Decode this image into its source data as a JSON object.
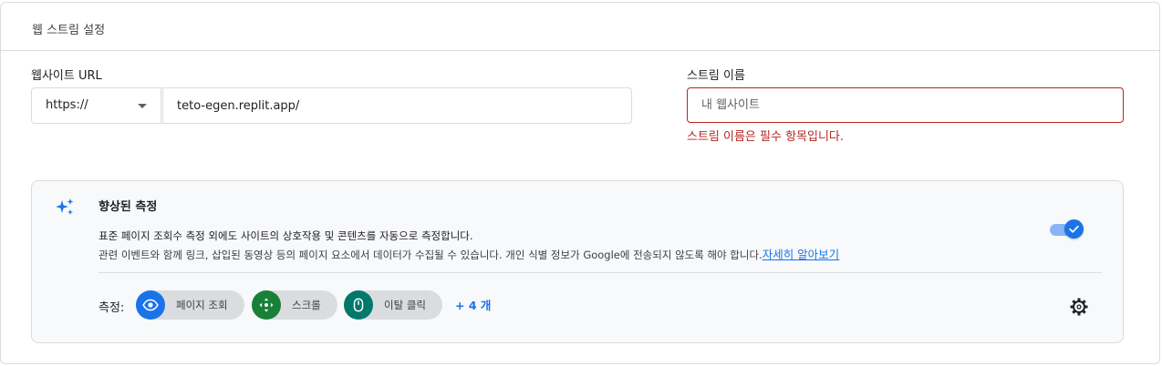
{
  "section": {
    "title": "웹 스트림 설정"
  },
  "website_url": {
    "label": "웹사이트 URL",
    "protocol": "https://",
    "value": "teto-egen.replit.app/"
  },
  "stream_name": {
    "label": "스트림 이름",
    "placeholder": "내 웹사이트",
    "error": "스트림 이름은 필수 항목입니다."
  },
  "enhanced_measurement": {
    "title": "향상된 측정",
    "description_1": "표준 페이지 조회수 측정 외에도 사이트의 상호작용 및 콘텐츠를 자동으로 측정합니다.",
    "description_2": "관련 이벤트와 함께 링크, 삽입된 동영상 등의 페이지 요소에서 데이터가 수집될 수 있습니다. 개인 식별 정보가 Google에 전송되지 않도록 해야 합니다.",
    "learn_more": "자세히 알아보기",
    "enabled": true,
    "measuring_label": "측정:",
    "chips": [
      {
        "label": "페이지 조회",
        "icon": "eye-icon",
        "color": "#1a73e8"
      },
      {
        "label": "스크롤",
        "icon": "scroll-icon",
        "color": "#188038"
      },
      {
        "label": "이탈 클릭",
        "icon": "mouse-icon",
        "color": "#00796b"
      }
    ],
    "more": "+ 4 개",
    "settings_icon": "gear-icon"
  },
  "colors": {
    "accent": "#1a73e8",
    "error": "#b3261e",
    "border": "#dadce0",
    "panel_bg": "#f8f9fa"
  }
}
